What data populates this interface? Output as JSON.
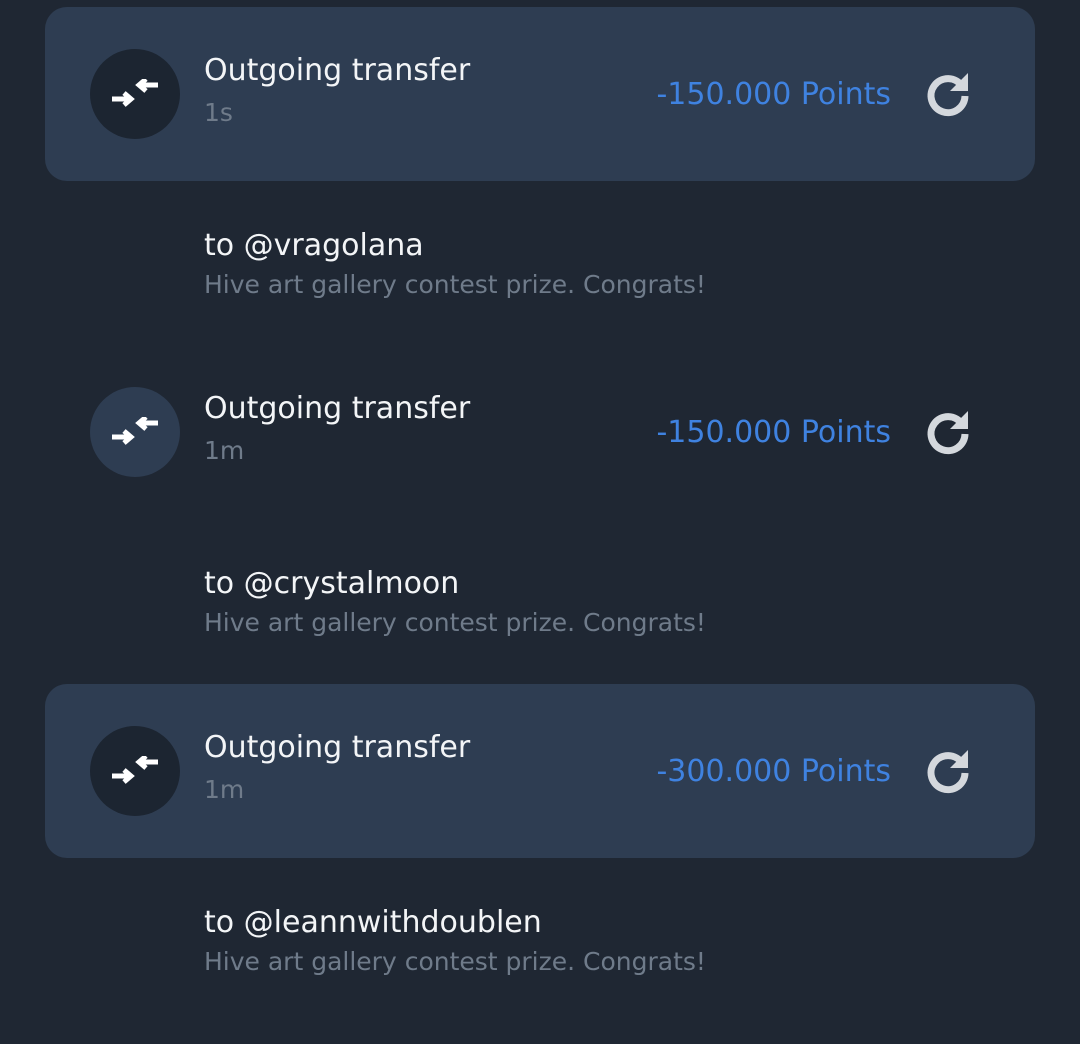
{
  "transactions": [
    {
      "title": "Outgoing transfer",
      "time": "1s",
      "amount": "-150.000 Points",
      "to": "to @vragolana",
      "memo": "Hive art gallery contest prize. Congrats!",
      "icon": "transfer-arrows-icon",
      "action_icon": "redo-icon"
    },
    {
      "title": "Outgoing transfer",
      "time": "1m",
      "amount": "-150.000 Points",
      "to": "to @crystalmoon",
      "memo": "Hive art gallery contest prize. Congrats!",
      "icon": "transfer-arrows-icon",
      "action_icon": "redo-icon"
    },
    {
      "title": "Outgoing transfer",
      "time": "1m",
      "amount": "-300.000 Points",
      "to": "to @leannwithdoublen",
      "memo": "Hive art gallery contest prize. Congrats!",
      "icon": "transfer-arrows-icon",
      "action_icon": "redo-icon"
    }
  ],
  "colors": {
    "background": "#1f2733",
    "highlight_card": "#2e3d52",
    "amount": "#3f82e0",
    "primary_text": "#f3f5f7",
    "secondary_text": "#6f7b8a"
  }
}
